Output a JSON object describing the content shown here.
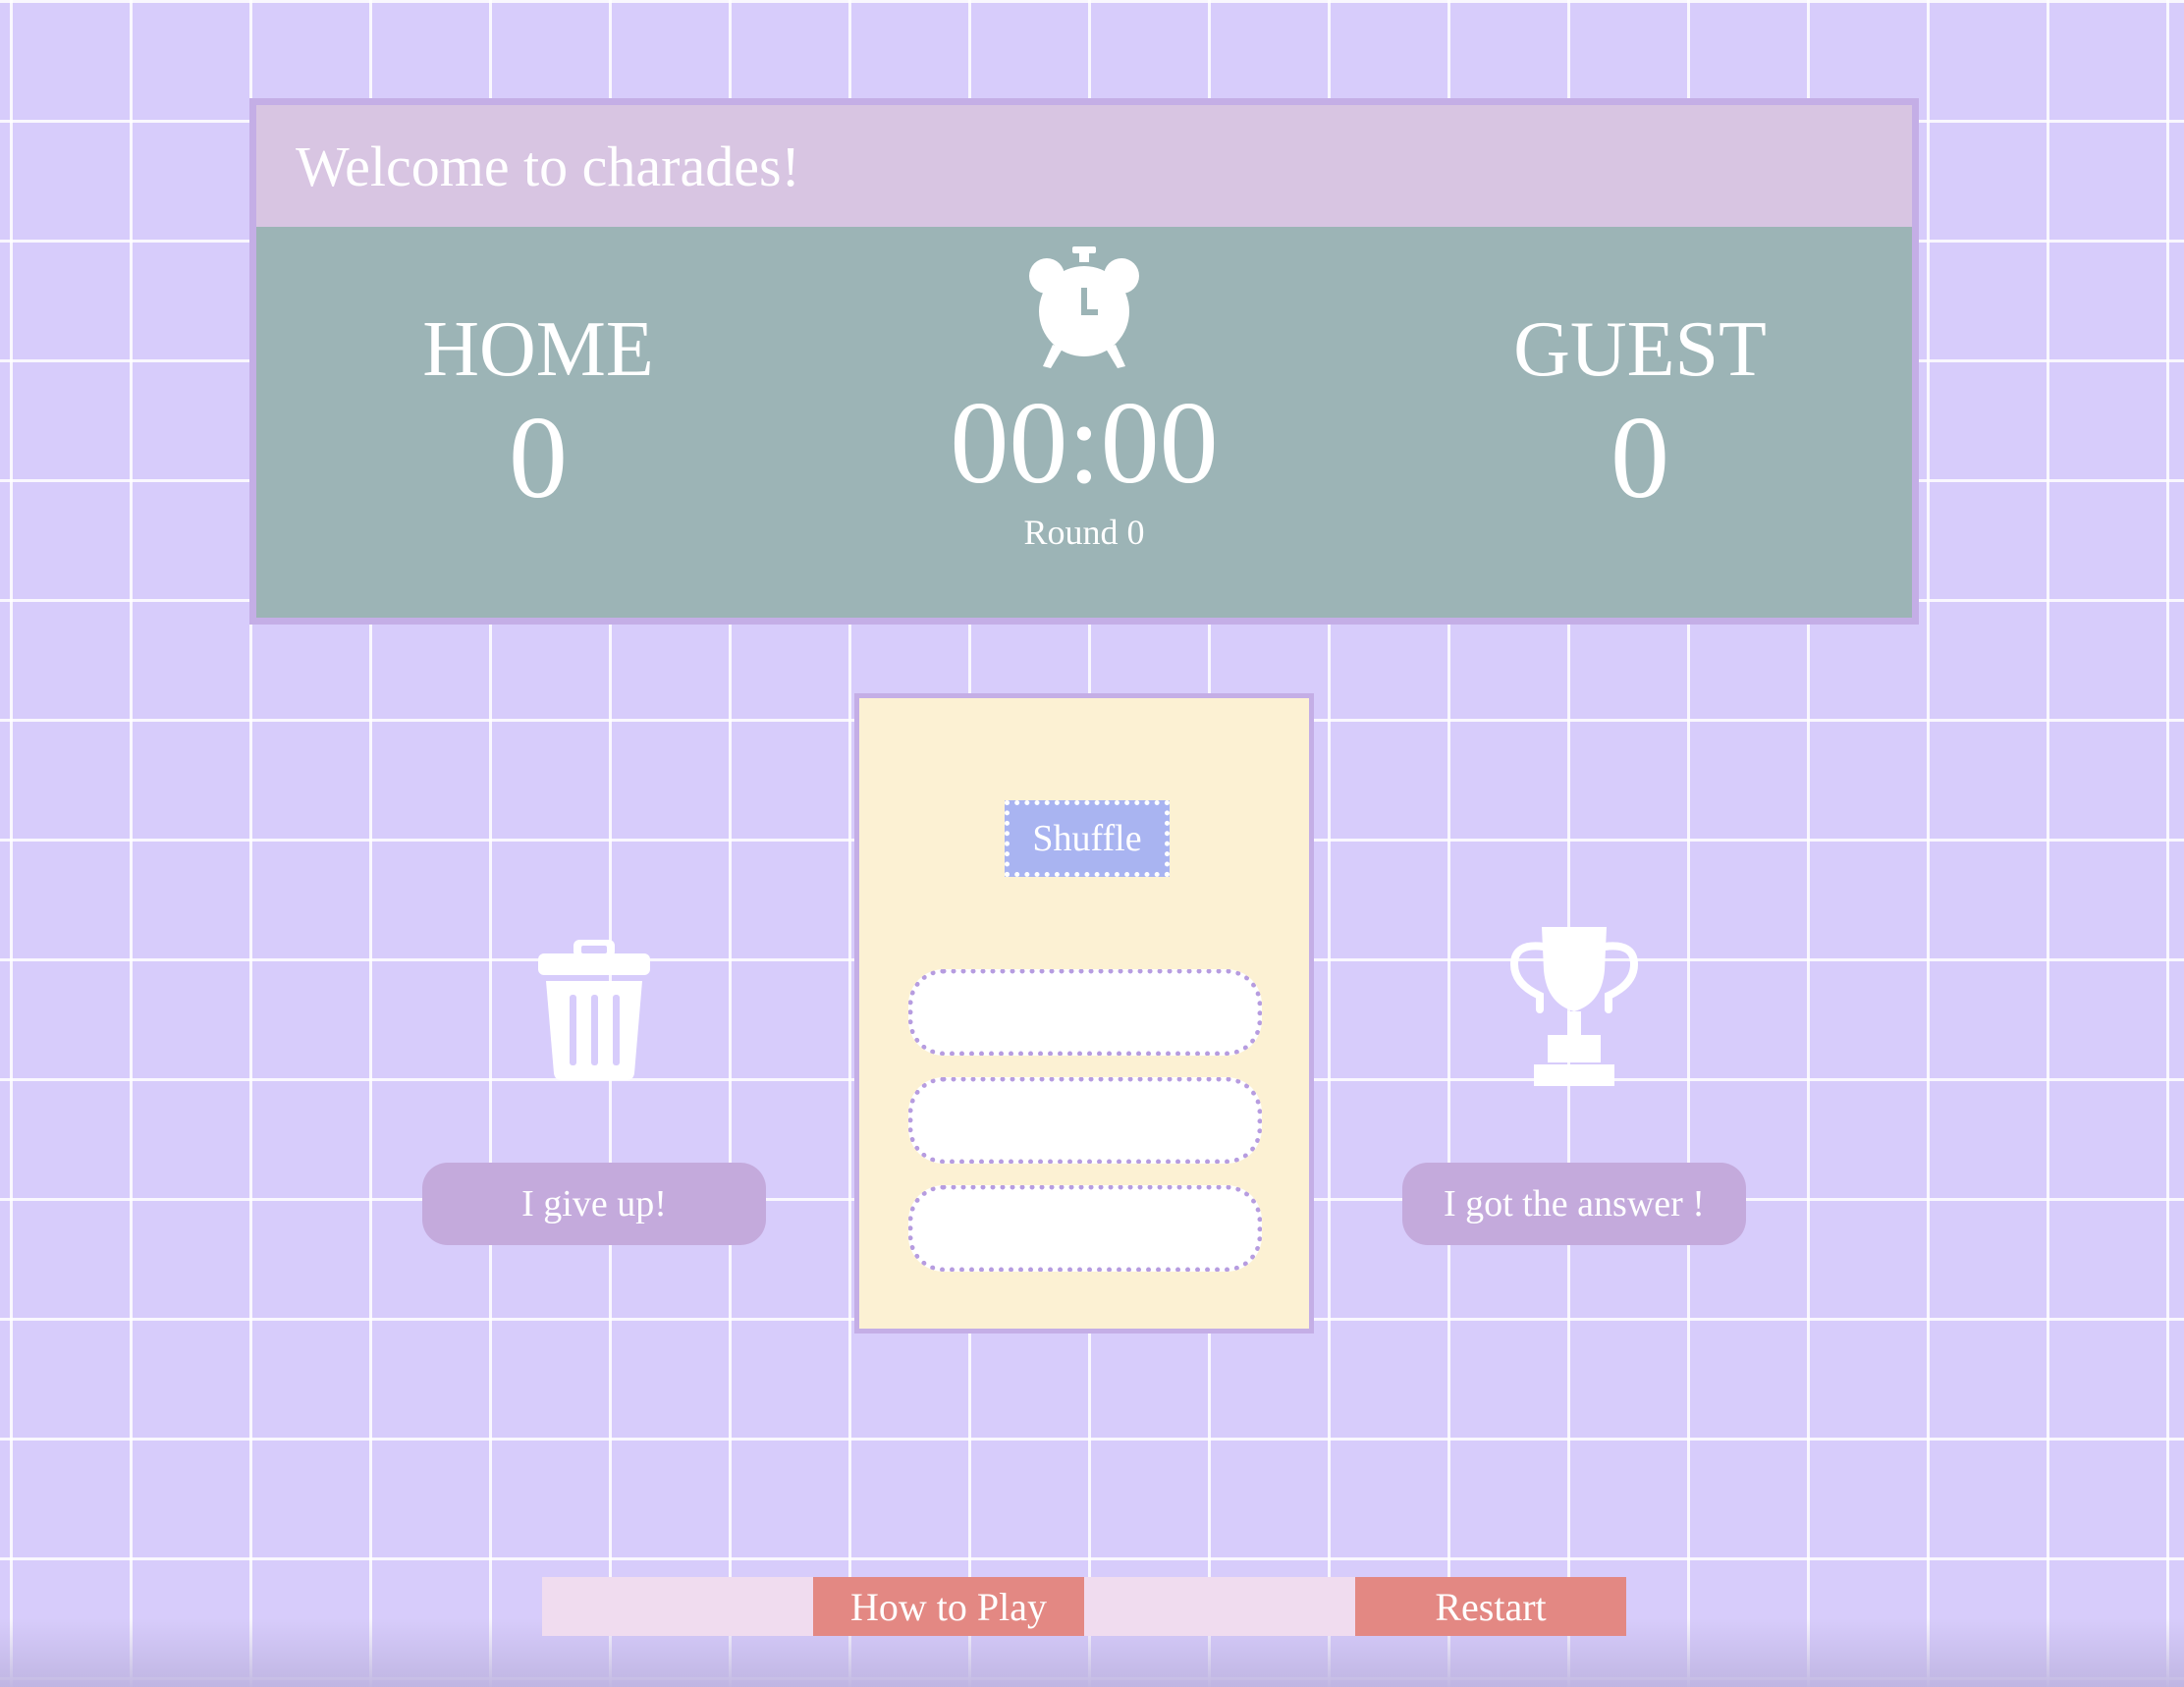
{
  "banner": {
    "title": "Welcome to charades!"
  },
  "scoreboard": {
    "home": {
      "label": "HOME",
      "score": "0"
    },
    "guest": {
      "label": "GUEST",
      "score": "0"
    },
    "timer": "00:00",
    "round": "Round 0"
  },
  "card": {
    "shuffle_label": "Shuffle",
    "word_slots": [
      "",
      "",
      ""
    ]
  },
  "actions": {
    "give_up_label": "I give up!",
    "got_answer_label": "I got the answer !"
  },
  "footer_nav": {
    "how_to_play_label": "How to Play",
    "restart_label": "Restart"
  },
  "colors": {
    "background": "#d7ccfb",
    "banner": "#d8c5e2",
    "board": "#9cb4b6",
    "border": "#c4aee6",
    "card": "#fcf1d3",
    "shuffle": "#a9b4f1",
    "pill_button": "#c4aadc",
    "nav_link": "#e38883",
    "nav_blank": "#f0dcef"
  },
  "icons": [
    "alarm-clock-icon",
    "trash-can-icon",
    "trophy-icon"
  ]
}
